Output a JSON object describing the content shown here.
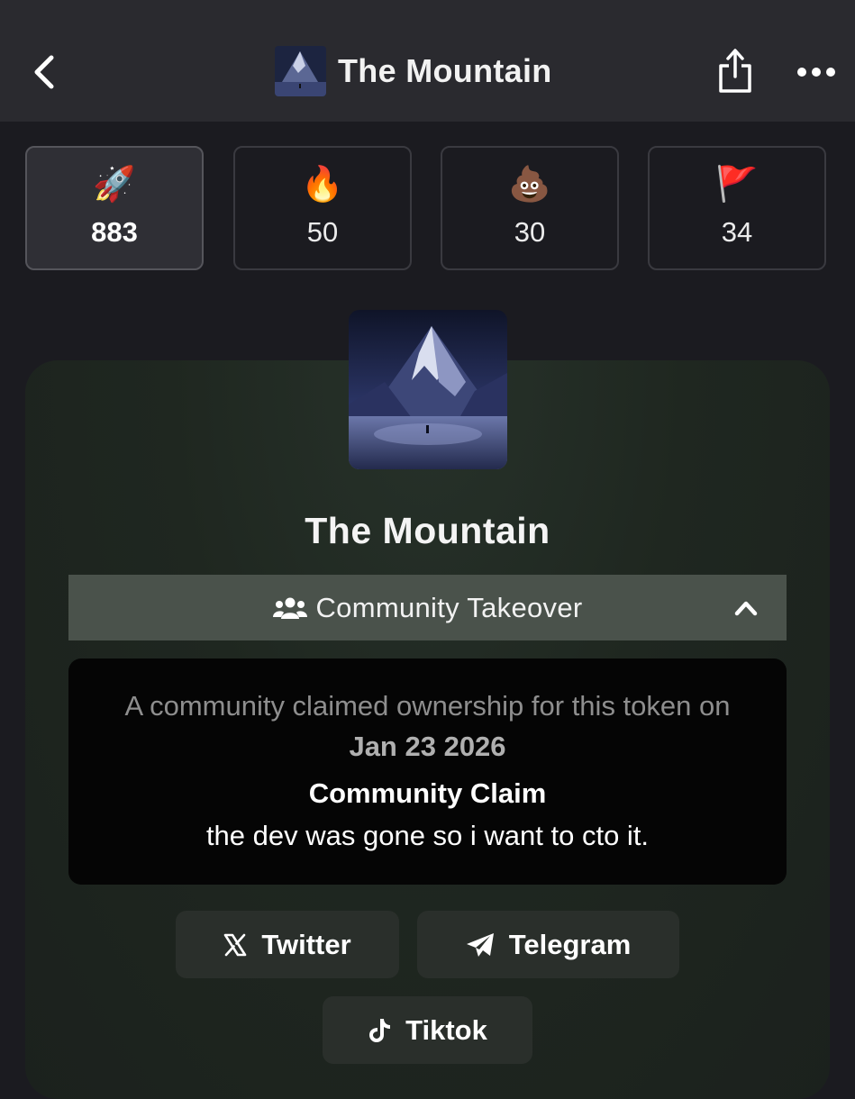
{
  "header": {
    "title": "The Mountain",
    "back_icon": "chevron-left-icon",
    "share_icon": "share-icon",
    "more_icon": "more-horizontal-icon"
  },
  "reactions": [
    {
      "emoji": "🚀",
      "count": "883",
      "active": true,
      "icon": "rocket-icon"
    },
    {
      "emoji": "🔥",
      "count": "50",
      "active": false,
      "icon": "fire-icon"
    },
    {
      "emoji": "💩",
      "count": "30",
      "active": false,
      "icon": "poop-icon"
    },
    {
      "emoji": "🚩",
      "count": "34",
      "active": false,
      "icon": "red-flag-icon"
    }
  ],
  "token": {
    "name": "The Mountain"
  },
  "cto": {
    "label": "Community Takeover",
    "icon": "users-icon",
    "expanded": true
  },
  "claim": {
    "text_prefix": "A community claimed ownership for this token on ",
    "date": "Jan 23 2026",
    "heading": "Community Claim",
    "body": "the dev was gone so i want to cto it."
  },
  "links": [
    {
      "label": "Twitter",
      "icon": "x-icon"
    },
    {
      "label": "Telegram",
      "icon": "telegram-icon"
    },
    {
      "label": "Tiktok",
      "icon": "tiktok-icon"
    }
  ],
  "colors": {
    "background": "#1b1b20",
    "header": "#2a2a2f",
    "cto_bar": "#4a524b",
    "claim_box": "#050505",
    "link_button": "#2a2f2b"
  }
}
